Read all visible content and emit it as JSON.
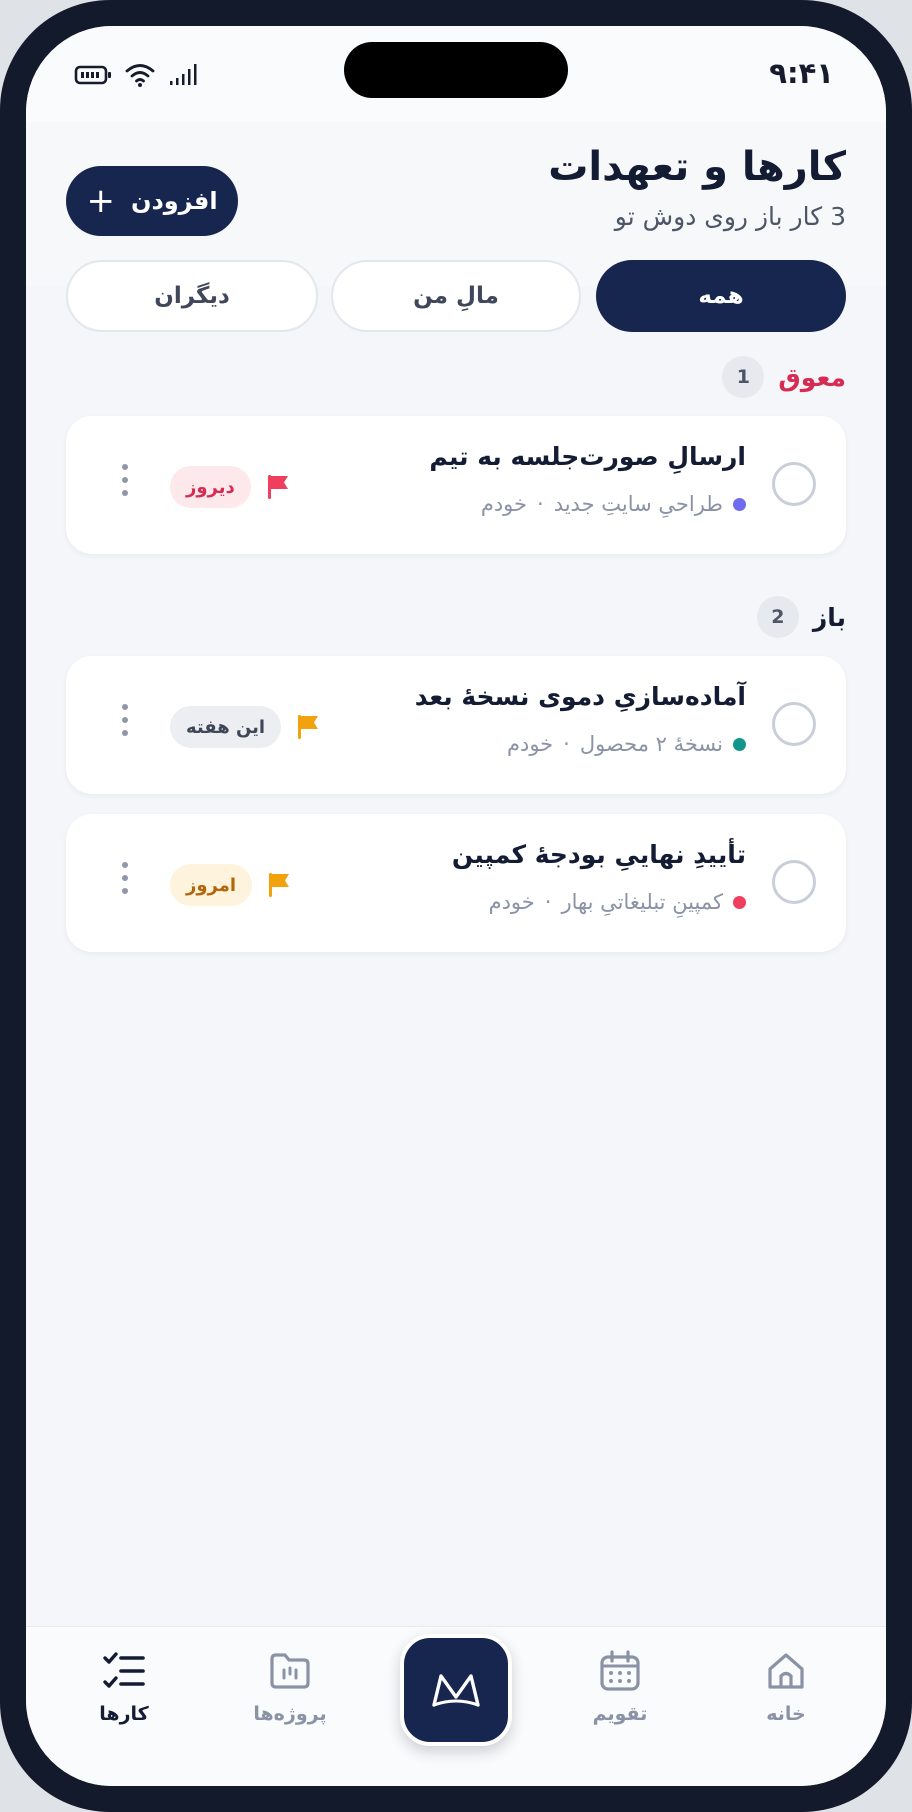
{
  "status_bar": {
    "time": "۹:۴۱"
  },
  "header": {
    "title": "کارها و تعهدات",
    "subtitle": "3 کار باز روی دوش تو",
    "add_label": "افزودن"
  },
  "filters": [
    {
      "label": "همه",
      "active": true
    },
    {
      "label": "مالِ من",
      "active": false
    },
    {
      "label": "دیگران",
      "active": false
    }
  ],
  "sections": {
    "overdue": {
      "label": "معوق",
      "count": "1",
      "color": "#d62b52"
    },
    "open": {
      "label": "باز",
      "count": "2",
      "color": "#141c34"
    }
  },
  "tasks": [
    {
      "title": "ارسالِ صورت‌جلسه به تیم",
      "project": "طراحیِ سایتِ جدید",
      "assignee": "خودم",
      "project_color": "#6f6cef",
      "due": "دیروز",
      "due_bg": "#fde8ec",
      "due_color": "#d62b52",
      "flag_color": "#ef3e5e"
    },
    {
      "title": "آماده‌سازیِ دموی نسخهٔ بعد",
      "project": "نسخهٔ ۲ محصول",
      "assignee": "خودم",
      "project_color": "#12958a",
      "due": "این هفته",
      "due_bg": "#eceef2",
      "due_color": "#3f4658",
      "flag_color": "#f2a20c"
    },
    {
      "title": "تأییدِ نهاییِ بودجهٔ کمپین",
      "project": "کمپینِ تبلیغاتیِ بهار",
      "assignee": "خودم",
      "project_color": "#ef3e5e",
      "due": "امروز",
      "due_bg": "#fef3dd",
      "due_color": "#b3650a",
      "flag_color": "#f2a20c"
    }
  ],
  "tabbar": {
    "home": "خانه",
    "calendar": "تقویم",
    "projects": "پروژه‌ها",
    "tasks": "کارها",
    "active": "tasks"
  },
  "meta_separator": "·"
}
